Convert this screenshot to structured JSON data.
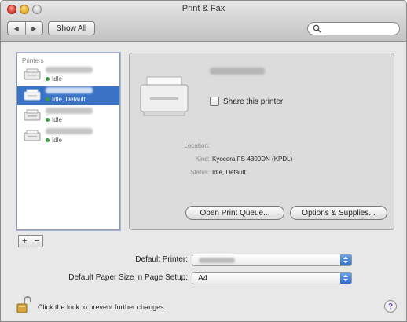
{
  "window": {
    "title": "Print & Fax",
    "show_all_label": "Show All",
    "nav_back_glyph": "◀",
    "nav_forward_glyph": "▶"
  },
  "search": {
    "placeholder": ""
  },
  "printers": {
    "header": "Printers",
    "items": [
      {
        "status": "Idle",
        "selected": false
      },
      {
        "status": "Idle, Default",
        "selected": true
      },
      {
        "status": "Idle",
        "selected": false
      },
      {
        "status": "Idle",
        "selected": false
      }
    ],
    "add_label": "+",
    "remove_label": "−"
  },
  "detail": {
    "share_label": "Share this printer",
    "location_label": "Location:",
    "location_value": "",
    "kind_label": "Kind:",
    "kind_value": "Kyocera FS-4300DN (KPDL)",
    "status_label": "Status:",
    "status_value": "Idle, Default",
    "open_queue_label": "Open Print Queue...",
    "options_label": "Options & Supplies..."
  },
  "settings": {
    "default_printer_label": "Default Printer:",
    "paper_size_label": "Default Paper Size in Page Setup:",
    "paper_size_value": "A4"
  },
  "footer": {
    "lock_message": "Click the lock to prevent further changes.",
    "help_label": "?"
  },
  "icons": {
    "traffic_lights": [
      "close",
      "minimize",
      "zoom"
    ],
    "search": "magnifier-icon",
    "printer": "printer-icon",
    "lock": "lock-open-icon",
    "help": "help-icon"
  },
  "colors": {
    "selection": "#3a73c6",
    "status_dot": "#3c9f3c",
    "popup_arrows": "#2f6cc8"
  }
}
